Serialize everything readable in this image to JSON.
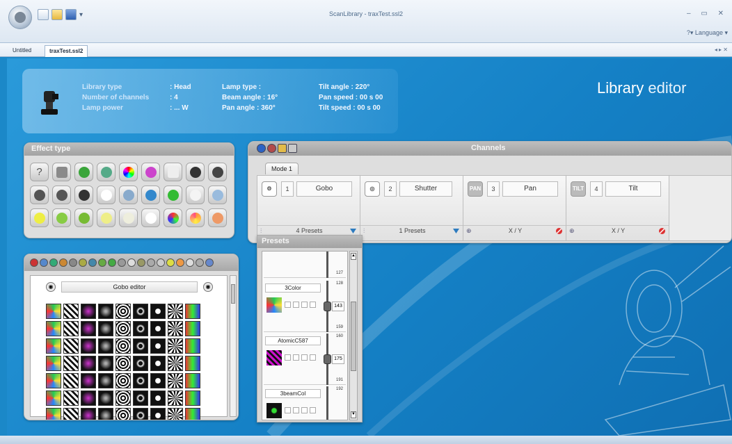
{
  "window": {
    "title": "ScanLibrary - traxTest.ssl2",
    "controls": "–  ▭  ✕",
    "language": "?▾ Language ▾"
  },
  "doc_tabs": [
    {
      "label": "Untitled"
    },
    {
      "label": "traxTest.ssl2"
    }
  ],
  "tab_nav": "◂ ▸ ✕",
  "page_title": {
    "a": "Library",
    "b": " editor"
  },
  "info": {
    "col1": [
      "Library type",
      "Number of channels",
      "Lamp power"
    ],
    "col1v": [
      ": Head",
      ": 4",
      ": ... W"
    ],
    "col2": [
      "Lamp type  :",
      "Beam angle : 16°",
      "Pan angle   : 360°"
    ],
    "col3": [
      "Tilt angle    : 220°",
      "Pan speed   : 00 s 00",
      "Tilt speed    : 00 s 00"
    ]
  },
  "effect_panel": {
    "title": "Effect type",
    "icons": [
      "question-icon",
      "pantilt-icon",
      "green-swirl-icon",
      "focus-icon",
      "color-wheel-icon",
      "gradient-icon",
      "white-square-icon",
      "gobo-icon",
      "gear-icon",
      "rotation-icon",
      "rotation-icon",
      "gobo-icon",
      "snowflake-icon",
      "cyan-icon",
      "shutter-icon",
      "green-icon",
      "white-blur-icon",
      "prism-icon",
      "yellow-iris-icon",
      "green-iris-icon",
      "leaf-icon",
      "bulb-icon",
      "frost-icon",
      "white-circle-icon",
      "color-mix-icon",
      "red-mix-icon",
      "orange-icon"
    ]
  },
  "gobo_panel": {
    "editor_title": "Gobo editor"
  },
  "channels": {
    "title": "Channels",
    "mode_tab": "Mode 1",
    "items": [
      {
        "num": "1",
        "name": "Gobo",
        "symbol": "",
        "footer": "4 Presets"
      },
      {
        "num": "2",
        "name": "Shutter",
        "symbol": "",
        "footer": "1 Presets"
      },
      {
        "num": "3",
        "name": "Pan",
        "symbol": "PAN",
        "footer": "X / Y"
      },
      {
        "num": "4",
        "name": "Tilt",
        "symbol": "TILT",
        "footer": "X / Y"
      }
    ]
  },
  "presets": {
    "title": "Presets",
    "items": [
      {
        "name": "",
        "value": "",
        "low": "",
        "high": "127"
      },
      {
        "name": "3Color",
        "value": "143",
        "low": "128",
        "high": "159"
      },
      {
        "name": "AtomicC587",
        "value": "175",
        "low": "160",
        "high": "191"
      },
      {
        "name": "3beamCol",
        "value": "",
        "low": "192",
        "high": ""
      }
    ]
  }
}
